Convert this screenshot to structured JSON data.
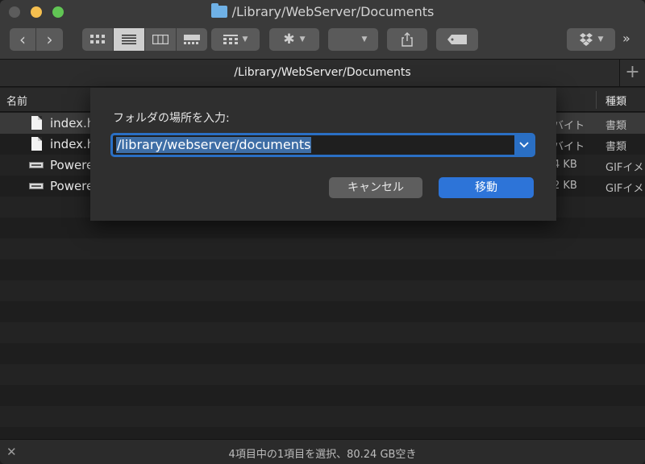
{
  "window": {
    "title": "/Library/WebServer/Documents"
  },
  "toolbar": {
    "back_glyph": "‹",
    "forward_glyph": "›",
    "more_glyph": "»"
  },
  "pathbar": {
    "path": "/Library/WebServer/Documents",
    "plus": "+"
  },
  "columns": {
    "name": "名前",
    "kind": "種類"
  },
  "files": [
    {
      "name": "index.h",
      "size": "バイト",
      "kind": "書類",
      "icon": "document-icon",
      "selected": true
    },
    {
      "name": "index.h",
      "size": "バイト",
      "kind": "書類",
      "icon": "document-icon",
      "selected": false
    },
    {
      "name": "Powere",
      "size": "4 KB",
      "kind": "GIFイメ",
      "icon": "gif-image-icon",
      "selected": false
    },
    {
      "name": "Powere",
      "size": "2 KB",
      "kind": "GIFイメ",
      "icon": "gif-image-icon",
      "selected": false
    }
  ],
  "dialog": {
    "prompt": "フォルダの場所を入力:",
    "value": "/library/webserver/documents",
    "cancel_label": "キャンセル",
    "go_label": "移動"
  },
  "status": {
    "text": "4項目中の1項目を選択、80.24 GB空き"
  },
  "colors": {
    "accent": "#2d74d8",
    "selection": "#3e6ea6"
  }
}
